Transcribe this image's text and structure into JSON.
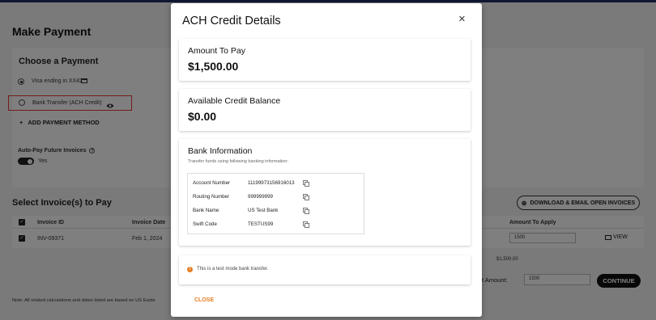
{
  "page": {
    "title": "Make Payment",
    "choose_payment_title": "Choose a Payment",
    "visa_label": "Visa ending in XX42",
    "bank_label": "Bank Transfer (ACH Credit)",
    "add_method_label": "ADD PAYMENT METHOD",
    "autopay_label": "Auto-Pay Future Invoices",
    "autopay_help": "?",
    "autopay_value": "Yes",
    "invoices_title": "Select Invoice(s) to Pay",
    "download_label": "DOWNLOAD & EMAIL OPEN INVOICES",
    "columns": {
      "invoice_id": "Invoice ID",
      "invoice_date": "Invoice Date",
      "amount_to_apply": "Amount To Apply"
    },
    "row": {
      "invoice_id": "INV-09371",
      "invoice_date": "Feb 1, 2024",
      "amount": "1500",
      "view": "VIEW"
    },
    "subtotal": "$1,500.00",
    "payment_amount_label": "Payment Amount:",
    "payment_amount_visible": "t Amount:",
    "payment_amount_value": "1500",
    "continue_label": "CONTINUE",
    "note": "Note: All related calculations and dates listed are based on US Easte"
  },
  "modal": {
    "title": "ACH Credit Details",
    "amount_label": "Amount To Pay",
    "amount_value": "$1,500.00",
    "credit_label": "Available Credit Balance",
    "credit_value": "$0.00",
    "bank_title": "Bank Information",
    "bank_subtitle": "Transfer funds using following banking information:",
    "bank_rows": [
      {
        "label": "Account Number",
        "value": "11199973156916013"
      },
      {
        "label": "Routing Number",
        "value": "999999999"
      },
      {
        "label": "Bank Name",
        "value": "US Test Bank"
      },
      {
        "label": "Swift Code",
        "value": "TESTUS99"
      }
    ],
    "warning_text": "This is a test mode bank transfer.",
    "close_label": "CLOSE",
    "close_icon": "×",
    "warning_icon": "!"
  },
  "colors": {
    "accent_orange": "#e67e22",
    "highlight_red": "#e53935",
    "top_bar": "#1f2f63"
  }
}
